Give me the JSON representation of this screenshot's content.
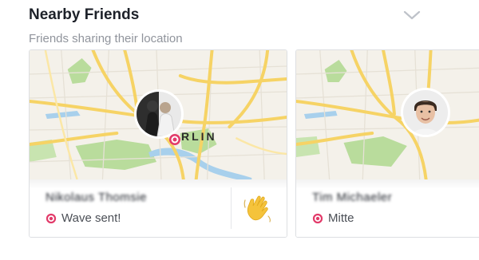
{
  "header": {
    "title": "Nearby Friends",
    "subtitle": "Friends sharing their location",
    "collapse_icon": "chevron-down-icon"
  },
  "cards": [
    {
      "name": "Nikolaus Thomsie",
      "status": "Wave sent!",
      "status_icon": "location-pin-icon",
      "action_icon": "waving-hand-icon",
      "map_city_label": "RLIN"
    },
    {
      "name": "Tim Michaeler",
      "status": "Mitte",
      "status_icon": "location-pin-icon"
    }
  ],
  "colors": {
    "map_background": "#f4f1ea",
    "map_roads": "#f6d365",
    "map_park": "#b9dc9c",
    "map_water": "#a8d0ec",
    "pin": "#e23b6a",
    "wave_hand": "#f5c33b"
  }
}
